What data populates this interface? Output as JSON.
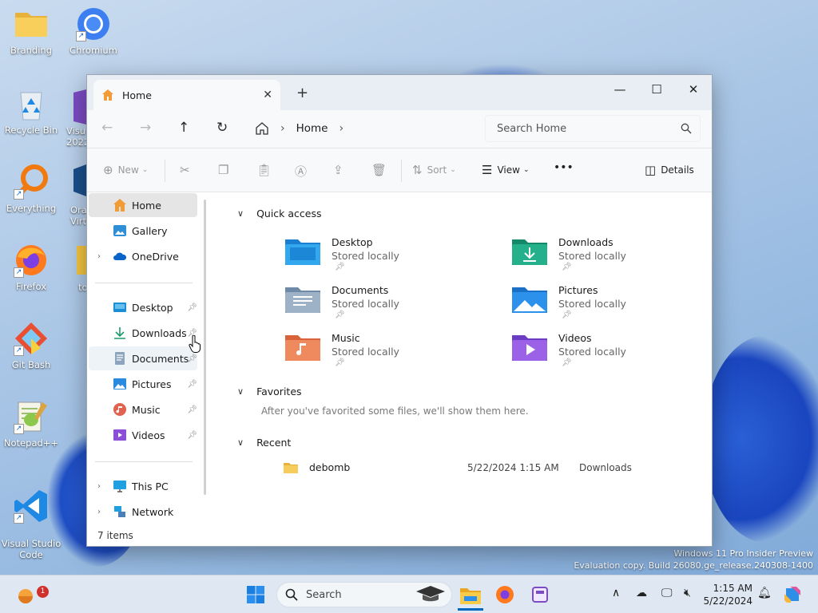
{
  "desktop": {
    "icons": [
      {
        "label": "Branding"
      },
      {
        "label": "Chromium"
      },
      {
        "label": "Recycle Bin"
      },
      {
        "label": "Everything"
      },
      {
        "label": "Firefox"
      },
      {
        "label": "Git Bash"
      },
      {
        "label": "Notepad++"
      },
      {
        "label": "Visual Studio\nCode"
      }
    ],
    "partial": [
      "Visu",
      "2022",
      "Ora",
      "Virt",
      "to"
    ],
    "watermark": {
      "line1": "Windows 11 Pro Insider Preview",
      "line2": "Evaluation copy. Build 26080.ge_release.240308-1400"
    }
  },
  "window": {
    "tab_title": "Home",
    "address": {
      "current": "Home"
    },
    "search_placeholder": "Search Home",
    "toolbar": {
      "new": "New",
      "sort": "Sort",
      "view": "View",
      "details": "Details",
      "more": "•••"
    },
    "nav": {
      "home": "Home",
      "gallery": "Gallery",
      "onedrive": "OneDrive",
      "desktop": "Desktop",
      "downloads": "Downloads",
      "documents": "Documents",
      "pictures": "Pictures",
      "music": "Music",
      "videos": "Videos",
      "thispc": "This PC",
      "network": "Network"
    },
    "status": "7 items",
    "sections": {
      "quick_access": "Quick access",
      "favorites": "Favorites",
      "recent": "Recent"
    },
    "quick_access": [
      {
        "name": "Desktop",
        "sub": "Stored locally"
      },
      {
        "name": "Downloads",
        "sub": "Stored locally"
      },
      {
        "name": "Documents",
        "sub": "Stored locally"
      },
      {
        "name": "Pictures",
        "sub": "Stored locally"
      },
      {
        "name": "Music",
        "sub": "Stored locally"
      },
      {
        "name": "Videos",
        "sub": "Stored locally"
      }
    ],
    "favorites_note": "After you've favorited some files, we'll show them here.",
    "recent": [
      {
        "name": "debomb",
        "date": "5/22/2024 1:15 AM",
        "location": "Downloads"
      }
    ]
  },
  "taskbar": {
    "search": "Search",
    "notification_count": "1",
    "time": "1:15 AM",
    "date": "5/22/2024"
  },
  "colors": {
    "accent": "#0067c0",
    "folder_yellow": "#f4c542",
    "taskbar": "#dfe8f2"
  }
}
